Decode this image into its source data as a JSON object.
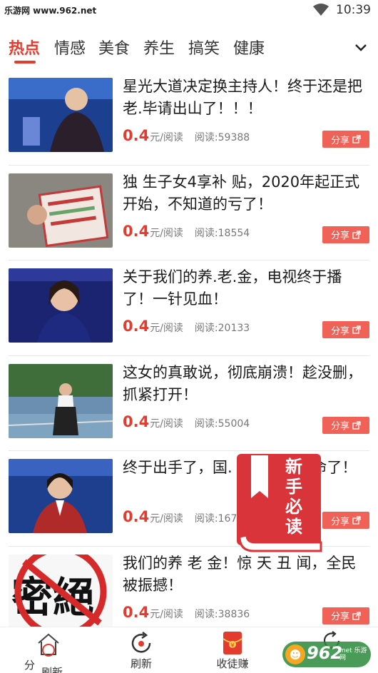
{
  "status_bar": {
    "watermark": "乐游网 www.962.net",
    "time": "10:39"
  },
  "tabs": [
    {
      "label": "热点",
      "active": true
    },
    {
      "label": "情感",
      "active": false
    },
    {
      "label": "美食",
      "active": false
    },
    {
      "label": "养生",
      "active": false
    },
    {
      "label": "搞笑",
      "active": false
    },
    {
      "label": "健康",
      "active": false
    }
  ],
  "articles": [
    {
      "title": "星光大道决定换主持人！终于还是把老.毕请出山了！！！",
      "price": "0.4",
      "price_unit": "元/阅读",
      "reads": "阅读:59388",
      "share": "分享"
    },
    {
      "title": "独 生子女4享补 贴，2020年起正式开始，不知道的亏了！",
      "price": "0.4",
      "price_unit": "元/阅读",
      "reads": "阅读:18554",
      "share": "分享"
    },
    {
      "title": "关于我们的养.老.金，电视终于播了！一针见血！",
      "price": "0.4",
      "price_unit": "元/阅读",
      "reads": "阅读:20133",
      "share": "分享"
    },
    {
      "title": "这女的真敢说，彻底崩溃！趁没删，抓紧打开！",
      "price": "0.4",
      "price_unit": "元/阅读",
      "reads": "阅读:55004",
      "share": "分享"
    },
    {
      "title": "终于出手了，国.              老百姓能活命了！",
      "price": "0.4",
      "price_unit": "元/阅读",
      "reads": "阅读:167",
      "share": "分享"
    },
    {
      "title": "我们的养 老 金！惊 天 丑 闻，全民被振撼！",
      "price": "0.4",
      "price_unit": "元/阅读",
      "reads": "阅读:38836",
      "share": "分享"
    }
  ],
  "guide_badge": {
    "text": "新手必读"
  },
  "bottom_nav": [
    {
      "label": "分"
    },
    {
      "label": "刷新"
    },
    {
      "label": "收徒赚"
    }
  ],
  "bottom_overlay_text": "刷新",
  "logo": {
    "text": "962",
    "sub": ".net 乐游网"
  },
  "colors": {
    "accent": "#e33b2e",
    "share_bg": "#f06157",
    "guide_bg": "#d9343a"
  }
}
